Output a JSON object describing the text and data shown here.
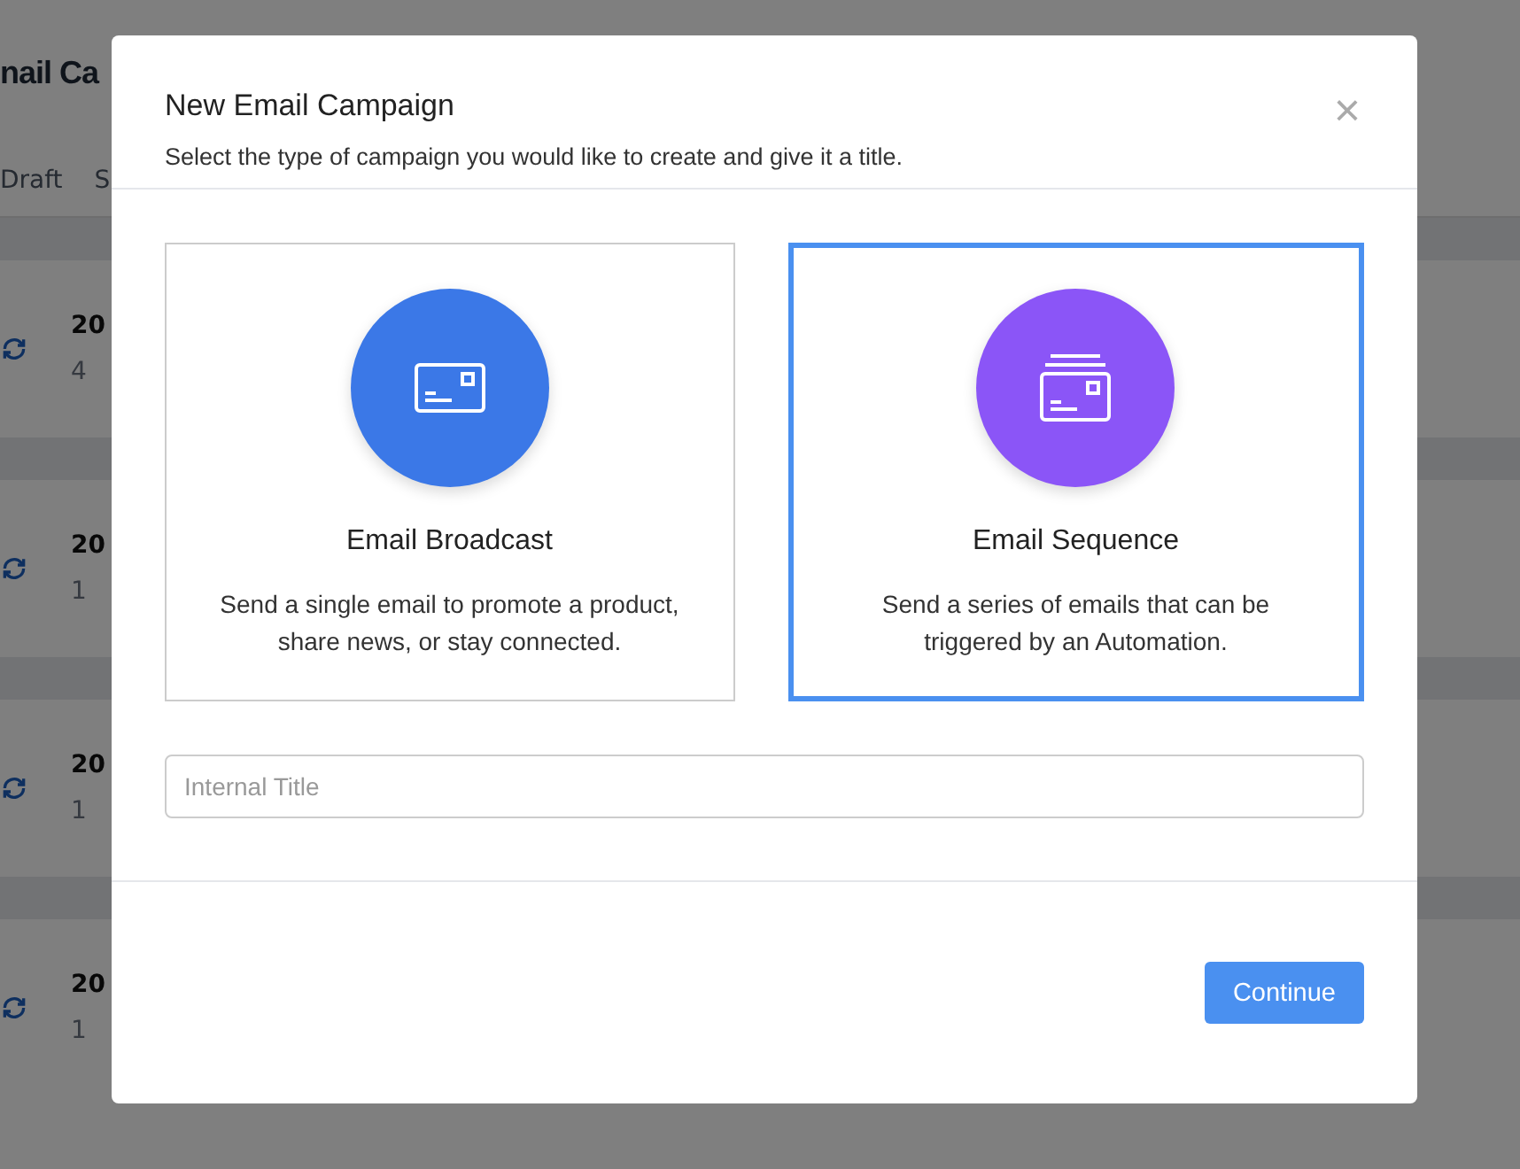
{
  "background_page": {
    "title": "nail Ca",
    "tabs": [
      {
        "label": "Draft"
      },
      {
        "label": "S"
      }
    ],
    "rows": [
      {
        "title": "20",
        "subtitle": "4"
      },
      {
        "title": "20",
        "subtitle": "1"
      },
      {
        "title": "20",
        "subtitle": "1"
      },
      {
        "title": "20",
        "subtitle": "1"
      }
    ]
  },
  "dialog": {
    "title": "New Email Campaign",
    "subtitle": "Select the type of campaign you would like to create and give it a title.",
    "close": "×",
    "options": [
      {
        "kind": "broadcast",
        "title": "Email Broadcast",
        "description": "Send a single email to promote a product, share news, or stay connected.",
        "color": "#3b78e7",
        "selected": false
      },
      {
        "kind": "sequence",
        "title": "Email Sequence",
        "description": "Send a series of emails that can be triggered by an Automation.",
        "color": "#8b55f7",
        "selected": true
      }
    ],
    "title_field": {
      "placeholder": "Internal Title"
    },
    "continue_button": "Continue"
  }
}
